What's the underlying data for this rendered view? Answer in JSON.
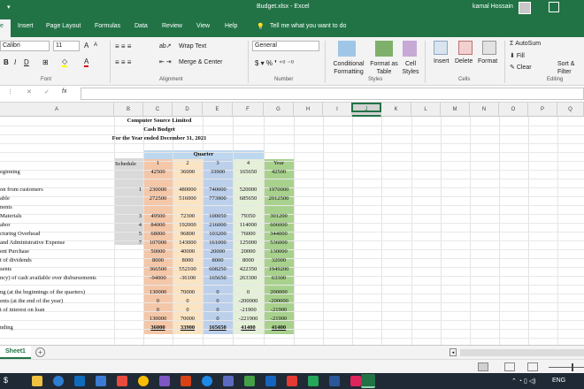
{
  "window": {
    "document_title": "Budget.xlsx  -  Excel",
    "user_name": "kamal Hossain"
  },
  "tabs": [
    "File",
    "Insert",
    "Page Layout",
    "Formulas",
    "Data",
    "Review",
    "View",
    "Help"
  ],
  "tell_me": "Tell me what you want to do",
  "ribbon": {
    "font_name": "Calibri",
    "font_size": "11",
    "font_group": "Font",
    "alignment_group": "Alignment",
    "wrap_text": "Wrap Text",
    "merge_center": "Merge & Center",
    "number_format": "General",
    "number_group": "Number",
    "conditional_formatting": "Conditional Formatting",
    "format_as_table": "Format as Table",
    "cell_styles": "Cell Styles",
    "styles_group": "Styles",
    "insert": "Insert",
    "delete": "Delete",
    "format": "Format",
    "cells_group": "Cells",
    "autosum": "AutoSum",
    "fill": "Fill",
    "clear": "Clear",
    "sort_filter": "Sort & Filter",
    "editing_group": "Editing"
  },
  "formula_bar": {
    "fx": "fx",
    "cancel": "✕",
    "enter": "✓",
    "value": ""
  },
  "columns": [
    "A",
    "B",
    "C",
    "D",
    "E",
    "F",
    "G",
    "H",
    "I",
    "J",
    "K",
    "L",
    "M",
    "N",
    "O",
    "P",
    "Q"
  ],
  "sheet": {
    "company": "Computer Source Limited",
    "report": "Cash Budget",
    "period": "For the Year ended December 31, 2021",
    "quarter_header": "Quarter",
    "schedule_header": "Schedule",
    "q_headers": [
      "1",
      "2",
      "3",
      "4",
      "Year"
    ],
    "rows": [
      {
        "label": "eginning",
        "sched": "",
        "v": [
          "42500",
          "36000",
          "33900",
          "165650",
          "42500"
        ]
      },
      {
        "label": "on from customers",
        "sched": "1",
        "v": [
          "230000",
          "480000",
          "740000",
          "520000",
          "1970000"
        ]
      },
      {
        "label": "able",
        "sched": "",
        "v": [
          "272500",
          "516000",
          "773900",
          "685650",
          "2012500"
        ]
      },
      {
        "label": "nents",
        "sched": "",
        "v": [
          "",
          "",
          "",
          "",
          ""
        ]
      },
      {
        "label": "Materials",
        "sched": "3",
        "v": [
          "49500",
          "72300",
          "100050",
          "79350",
          "301200"
        ]
      },
      {
        "label": "abor",
        "sched": "4",
        "v": [
          "84000",
          "192000",
          "216000",
          "114000",
          "606000"
        ]
      },
      {
        "label": "cturing Overhead",
        "sched": "5",
        "v": [
          "68000",
          "96800",
          "103200",
          "76000",
          "344000"
        ]
      },
      {
        "label": "and Administrative Expense",
        "sched": "7",
        "v": [
          "107000",
          "143000",
          "161000",
          "125000",
          "536000"
        ]
      },
      {
        "label": "ent Purchase",
        "sched": "",
        "v": [
          "50000",
          "40000",
          "20000",
          "20000",
          "130000"
        ]
      },
      {
        "label": "t of dividends",
        "sched": "",
        "v": [
          "8000",
          "8000",
          "8000",
          "8000",
          "32000"
        ]
      },
      {
        "label": "sents",
        "sched": "",
        "v": [
          "366500",
          "552100",
          "608250",
          "422350",
          "1949200"
        ]
      },
      {
        "label": "ncy) of cash available over disbursements",
        "sched": "",
        "v": [
          "-94000",
          "-36100",
          "165650",
          "263300",
          "63300"
        ]
      },
      {
        "label": "ng (at the beginnings of the quarters)",
        "sched": "",
        "v": [
          "130000",
          "70000",
          "0",
          "0",
          "200000"
        ]
      },
      {
        "label": "ents (at the end of the year)",
        "sched": "",
        "v": [
          "0",
          "0",
          "0",
          "-200000",
          "-200000"
        ]
      },
      {
        "label": "t of interest on loan",
        "sched": "",
        "v": [
          "0",
          "0",
          "0",
          "-21900",
          "-21900"
        ]
      },
      {
        "label": "",
        "sched": "",
        "v": [
          "130000",
          "70000",
          "0",
          "-221900",
          "-21900"
        ]
      },
      {
        "label": "nding",
        "sched": "",
        "v": [
          "36000",
          "33900",
          "165650",
          "41400",
          "41400"
        ]
      }
    ]
  },
  "sheet_tab": "Sheet1",
  "colors": {
    "excel_green": "#217346",
    "q1": "#f4c7a9",
    "q2": "#fbe4c3",
    "q3": "#bcd0ec",
    "q4": "#e4f0d8",
    "year": "#a9d18e",
    "schedule": "#d9d9d9",
    "quarter": "#bdd7ee"
  },
  "tray": {
    "lang": "ENG"
  }
}
